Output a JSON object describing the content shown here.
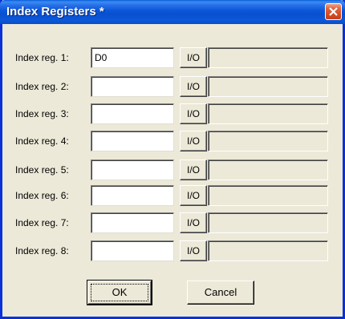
{
  "window": {
    "title": "Index Registers *"
  },
  "registers": [
    {
      "label": "Index reg. 1:",
      "value": "D0",
      "io_label": "I/O"
    },
    {
      "label": "Index reg. 2:",
      "value": "",
      "io_label": "I/O"
    },
    {
      "label": "Index reg. 3:",
      "value": "",
      "io_label": "I/O"
    },
    {
      "label": "Index reg. 4:",
      "value": "",
      "io_label": "I/O"
    },
    {
      "label": "Index reg. 5:",
      "value": "",
      "io_label": "I/O"
    },
    {
      "label": "Index reg. 6:",
      "value": "",
      "io_label": "I/O"
    },
    {
      "label": "Index reg. 7:",
      "value": "",
      "io_label": "I/O"
    },
    {
      "label": "Index reg. 8:",
      "value": "",
      "io_label": "I/O"
    }
  ],
  "buttons": {
    "ok": "OK",
    "cancel": "Cancel"
  },
  "colors": {
    "titlebar": "#0a55d8",
    "close": "#d14b22",
    "face": "#ece9d8"
  },
  "icons": {
    "close": "close-icon"
  }
}
